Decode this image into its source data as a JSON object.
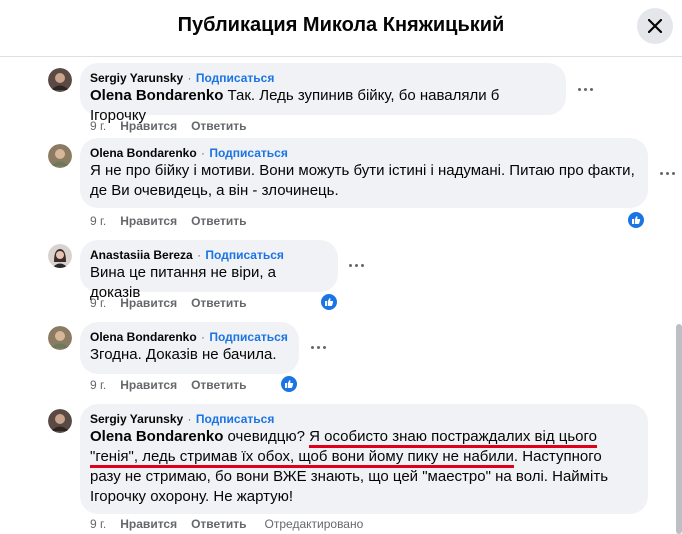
{
  "header": {
    "title": "Публикация Микола Княжицький",
    "close_icon": "close-icon"
  },
  "labels": {
    "subscribe": "Подписаться",
    "like": "Нравится",
    "reply": "Ответить",
    "separator": "·"
  },
  "comments": [
    {
      "author": "Sergiy Yarunsky",
      "mention": "Olena Bondarenko",
      "text": " Так. Ледь зупинив бійку, бо наваляли б Ігорочку",
      "time": "9 г."
    },
    {
      "author": "Olena Bondarenko",
      "line1": "Я не про бійку і мотиви. Вони можуть бути істині і надумані. Питаю про факти,",
      "line2": "де Ви очевидець, а він - злочинець.",
      "time": "9 г."
    },
    {
      "author": "Anastasiia Bereza",
      "text": "Вина це питання не віри, а доказів",
      "time": "9 г."
    },
    {
      "author": "Olena Bondarenko",
      "text": "Згодна. Доказів не бачила.",
      "time": "9 г."
    },
    {
      "author": "Sergiy Yarunsky",
      "mention": "Olena Bondarenko",
      "l1_a": " очевидцю? ",
      "l1_b": "Я особисто знаю постраждалих від цього",
      "l2_a": "\"генія\", ледь стримав їх обох, щоб вони йому пику не набили",
      "l2_b": ". Наступного",
      "l3": "разу не стримаю, бо вони ВЖЕ знають, що цей \"маестро\" на волі. Найміть",
      "l4": "Ігорочку охорону. Не жартую!",
      "time": "9 г.",
      "edited": "Отредактировано"
    }
  ],
  "colors": {
    "accent": "#1b74e4",
    "bubble": "#f0f2f5",
    "meta": "#65676b",
    "underline": "#e0001b"
  }
}
